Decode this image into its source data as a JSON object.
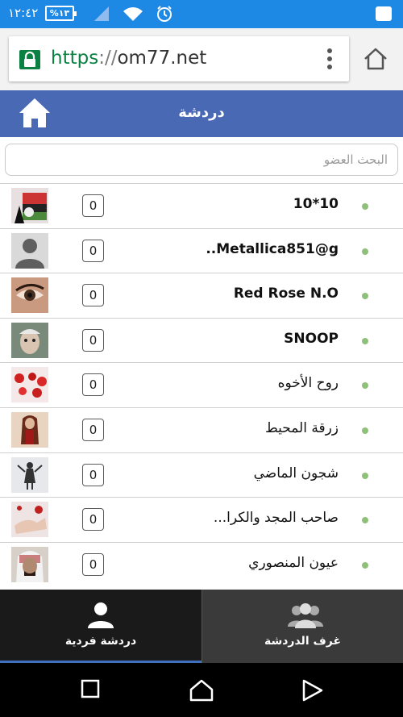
{
  "status_bar": {
    "time": "١٢:٤٢",
    "battery": "%١٣"
  },
  "browser": {
    "url_scheme": "https",
    "url_sep": "://",
    "url_host": "om77.net"
  },
  "header": {
    "title": "دردشة"
  },
  "search": {
    "placeholder": "البحث العضو"
  },
  "members": [
    {
      "name": "10*10",
      "count": "0",
      "avatar": "flag-photo"
    },
    {
      "name": "..Metallica851@g",
      "count": "0",
      "avatar": "default-user"
    },
    {
      "name": "Red Rose N.O",
      "count": "0",
      "avatar": "eye-photo"
    },
    {
      "name": "SNOOP",
      "count": "0",
      "avatar": "face-photo"
    },
    {
      "name": "روح الأخوه",
      "count": "0",
      "avatar": "hearts-photo"
    },
    {
      "name": "زرقة المحيط",
      "count": "0",
      "avatar": "woman-photo"
    },
    {
      "name": "شجون الماضي",
      "count": "0",
      "avatar": "silhouette-photo"
    },
    {
      "name": "صاحب المجد والكرا...",
      "count": "0",
      "avatar": "hands-photo"
    },
    {
      "name": "عيون المنصوري",
      "count": "0",
      "avatar": "man-photo"
    }
  ],
  "tabs": {
    "private_chat": "دردشة فردية",
    "chat_rooms": "غرف الدردشة"
  },
  "colors": {
    "status_bar": "#1e88e5",
    "header": "#4a69b5",
    "online": "#8fc07a"
  }
}
